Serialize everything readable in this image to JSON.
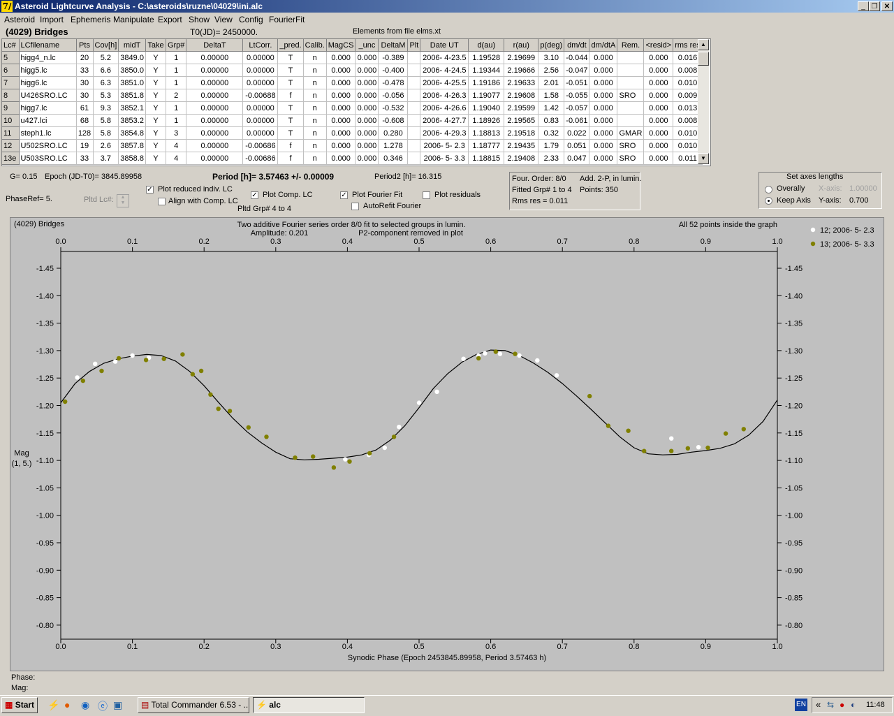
{
  "window": {
    "title": "Asteroid Lightcurve Analysis - C:\\asteroids\\ruzne\\04029\\ini.alc",
    "app_icon": "7/",
    "controls": [
      "minimize-icon",
      "restore-icon",
      "close-icon"
    ]
  },
  "menu": [
    "Asteroid",
    "Import",
    "Ephemeris",
    "Manipulate",
    "Export",
    "Show",
    "View",
    "Config",
    "FourierFit"
  ],
  "header": {
    "asteroid": "(4029) Bridges",
    "t0": "T0(JD)= 2450000.",
    "elements": "Elements from file elms.xt"
  },
  "table": {
    "columns": [
      "Lc#",
      "LCfilename",
      "Pts",
      "Cov[h]",
      "midT",
      "Take",
      "Grp#",
      "DeltaT",
      "LtCorr.",
      "_pred.",
      "Calib.",
      "MagCS",
      "_unc",
      "DeltaM",
      "Plt",
      "Date UT",
      "d(au)",
      "r(au)",
      "p(deg)",
      "dm/dt",
      "dm/dtA",
      "Rem.",
      "<resid>",
      "rms res"
    ],
    "rows": [
      [
        "5",
        "higg4_n.lc",
        "20",
        "5.2",
        "3849.0",
        "Y",
        "1",
        "0.00000",
        "0.00000",
        "T",
        "n",
        "0.000",
        "0.000",
        "-0.389",
        "",
        "2006- 4-23.5",
        "1.19528",
        "2.19699",
        "3.10",
        "-0.044",
        "0.000",
        "",
        "0.000",
        "0.016"
      ],
      [
        "6",
        "higg5.lc",
        "33",
        "6.6",
        "3850.0",
        "Y",
        "1",
        "0.00000",
        "0.00000",
        "T",
        "n",
        "0.000",
        "0.000",
        "-0.400",
        "",
        "2006- 4-24.5",
        "1.19344",
        "2.19666",
        "2.56",
        "-0.047",
        "0.000",
        "",
        "0.000",
        "0.008"
      ],
      [
        "7",
        "higg6.lc",
        "30",
        "6.3",
        "3851.0",
        "Y",
        "1",
        "0.00000",
        "0.00000",
        "T",
        "n",
        "0.000",
        "0.000",
        "-0.478",
        "",
        "2006- 4-25.5",
        "1.19186",
        "2.19633",
        "2.01",
        "-0.051",
        "0.000",
        "",
        "0.000",
        "0.010"
      ],
      [
        "8",
        "U426SRO.LC",
        "30",
        "5.3",
        "3851.8",
        "Y",
        "2",
        "0.00000",
        "-0.00688",
        "f",
        "n",
        "0.000",
        "0.000",
        "-0.056",
        "",
        "2006- 4-26.3",
        "1.19077",
        "2.19608",
        "1.58",
        "-0.055",
        "0.000",
        "SRO",
        "0.000",
        "0.009"
      ],
      [
        "9",
        "higg7.lc",
        "61",
        "9.3",
        "3852.1",
        "Y",
        "1",
        "0.00000",
        "0.00000",
        "T",
        "n",
        "0.000",
        "0.000",
        "-0.532",
        "",
        "2006- 4-26.6",
        "1.19040",
        "2.19599",
        "1.42",
        "-0.057",
        "0.000",
        "",
        "0.000",
        "0.013"
      ],
      [
        "10",
        "u427.lci",
        "68",
        "5.8",
        "3853.2",
        "Y",
        "1",
        "0.00000",
        "0.00000",
        "T",
        "n",
        "0.000",
        "0.000",
        "-0.608",
        "",
        "2006- 4-27.7",
        "1.18926",
        "2.19565",
        "0.83",
        "-0.061",
        "0.000",
        "",
        "0.000",
        "0.008"
      ],
      [
        "11",
        "steph1.lc",
        "128",
        "5.8",
        "3854.8",
        "Y",
        "3",
        "0.00000",
        "0.00000",
        "T",
        "n",
        "0.000",
        "0.000",
        "0.280",
        "",
        "2006- 4-29.3",
        "1.18813",
        "2.19518",
        "0.32",
        "0.022",
        "0.000",
        "GMAR",
        "0.000",
        "0.010"
      ],
      [
        "12",
        "U502SRO.LC",
        "19",
        "2.6",
        "3857.8",
        "Y",
        "4",
        "0.00000",
        "-0.00686",
        "f",
        "n",
        "0.000",
        "0.000",
        "1.278",
        "",
        "2006- 5- 2.3",
        "1.18777",
        "2.19435",
        "1.79",
        "0.051",
        "0.000",
        "SRO",
        "0.000",
        "0.010"
      ],
      [
        "13e",
        "U503SRO.LC",
        "33",
        "3.7",
        "3858.8",
        "Y",
        "4",
        "0.00000",
        "-0.00686",
        "f",
        "n",
        "0.000",
        "0.000",
        "0.346",
        "",
        "2006- 5- 3.3",
        "1.18815",
        "2.19408",
        "2.33",
        "0.047",
        "0.000",
        "SRO",
        "0.000",
        "0.011"
      ]
    ]
  },
  "info": {
    "g": "G= 0.15",
    "epoch": "Epoch (JD-T0)= 3845.89958",
    "period": "Period [h]= 3.57463 +/- 0.00009",
    "period2": "Period2 [h]= 16.315",
    "phaseref": "PhaseRef= 5.",
    "pltd_lc": "Pltd Lc#:",
    "pltd_grp": "Pltd Grp#  4  to   4"
  },
  "checkboxes": {
    "plot_reduced": {
      "label": "Plot reduced indiv. LC",
      "checked": true
    },
    "align_comp": {
      "label": "Align with Comp. LC",
      "checked": false
    },
    "plot_comp": {
      "label": "Plot Comp. LC",
      "checked": true
    },
    "plot_fourier": {
      "label": "Plot Fourier Fit",
      "checked": true
    },
    "plot_residuals": {
      "label": "Plot residuals",
      "checked": false
    },
    "autorefit": {
      "label": "AutoRefit Fourier",
      "checked": false
    }
  },
  "fourier_panel": {
    "order": "Four. Order:  8/0",
    "add": "Add. 2-P, in lumin.",
    "fitted": "Fitted Grp# 1 to 4",
    "points": "Points: 350",
    "rms": "Rms res      = 0.011"
  },
  "axes_panel": {
    "title": "Set axes lengths",
    "overally": "Overally",
    "keep_axis": "Keep Axis",
    "selected": "keep_axis",
    "x_label": "X-axis:",
    "x_value": "1.00000",
    "y_label": "Y-axis:",
    "y_value": "0.700"
  },
  "plot": {
    "name": "(4029) Bridges",
    "desc1": "Two additive Fourier series order 8/0 fit to selected groups in lumin.",
    "desc2": "Amplitude: 0.201",
    "desc3": "P2-component removed in plot",
    "inside": "All 52 points inside the graph",
    "ylabel1": "Mag",
    "ylabel2": "(1, 5.)",
    "xlabel": "Synodic Phase (Epoch 2453845.89958, Period 3.57463 h)",
    "phase_label": "Phase:",
    "mag_label": "Mag:"
  },
  "chart_data": {
    "type": "scatter",
    "xlim": [
      0,
      1
    ],
    "ylim": [
      -1.45,
      -0.8
    ],
    "y_inverted": true,
    "x_ticks": [
      "0.0",
      "0.1",
      "0.2",
      "0.3",
      "0.4",
      "0.5",
      "0.6",
      "0.7",
      "0.8",
      "0.9",
      "1.0"
    ],
    "y_ticks": [
      "-1.45",
      "-1.40",
      "-1.35",
      "-1.30",
      "-1.25",
      "-1.20",
      "-1.15",
      "-1.10",
      "-1.05",
      "-1.00",
      "-0.95",
      "-0.90",
      "-0.85",
      "-0.80"
    ],
    "grid": false,
    "legend_position": "right",
    "colors": {
      "series12": "#ffffff",
      "series13": "#808000",
      "fit": "#000000"
    },
    "series": [
      {
        "name": "12; 2006- 5- 2.3",
        "color": "#ffffff",
        "points": [
          [
            0.023,
            -1.251
          ],
          [
            0.048,
            -1.276
          ],
          [
            0.076,
            -1.28
          ],
          [
            0.1,
            -1.291
          ],
          [
            0.123,
            -1.287
          ],
          [
            0.397,
            -1.102
          ],
          [
            0.43,
            -1.11
          ],
          [
            0.452,
            -1.123
          ],
          [
            0.472,
            -1.161
          ],
          [
            0.5,
            -1.205
          ],
          [
            0.525,
            -1.225
          ],
          [
            0.562,
            -1.285
          ],
          [
            0.583,
            -1.291
          ],
          [
            0.592,
            -1.295
          ],
          [
            0.613,
            -1.294
          ],
          [
            0.64,
            -1.291
          ],
          [
            0.665,
            -1.282
          ],
          [
            0.692,
            -1.255
          ],
          [
            0.852,
            -1.14
          ],
          [
            0.89,
            -1.124
          ]
        ]
      },
      {
        "name": "13; 2006- 5- 3.3",
        "color": "#808000",
        "points": [
          [
            0.006,
            -1.207
          ],
          [
            0.031,
            -1.245
          ],
          [
            0.057,
            -1.263
          ],
          [
            0.081,
            -1.286
          ],
          [
            0.119,
            -1.283
          ],
          [
            0.144,
            -1.285
          ],
          [
            0.17,
            -1.293
          ],
          [
            0.184,
            -1.257
          ],
          [
            0.196,
            -1.263
          ],
          [
            0.209,
            -1.22
          ],
          [
            0.22,
            -1.194
          ],
          [
            0.236,
            -1.19
          ],
          [
            0.262,
            -1.16
          ],
          [
            0.287,
            -1.143
          ],
          [
            0.327,
            -1.105
          ],
          [
            0.352,
            -1.107
          ],
          [
            0.381,
            -1.087
          ],
          [
            0.403,
            -1.098
          ],
          [
            0.431,
            -1.113
          ],
          [
            0.465,
            -1.143
          ],
          [
            0.583,
            -1.286
          ],
          [
            0.607,
            -1.298
          ],
          [
            0.634,
            -1.294
          ],
          [
            0.738,
            -1.217
          ],
          [
            0.764,
            -1.163
          ],
          [
            0.792,
            -1.154
          ],
          [
            0.814,
            -1.117
          ],
          [
            0.852,
            -1.117
          ],
          [
            0.875,
            -1.122
          ],
          [
            0.903,
            -1.123
          ],
          [
            0.928,
            -1.149
          ],
          [
            0.953,
            -1.157
          ]
        ]
      }
    ],
    "fit_curve": [
      [
        0.0,
        -1.205
      ],
      [
        0.02,
        -1.24
      ],
      [
        0.04,
        -1.262
      ],
      [
        0.06,
        -1.277
      ],
      [
        0.08,
        -1.285
      ],
      [
        0.1,
        -1.29
      ],
      [
        0.12,
        -1.293
      ],
      [
        0.14,
        -1.291
      ],
      [
        0.16,
        -1.281
      ],
      [
        0.18,
        -1.262
      ],
      [
        0.2,
        -1.236
      ],
      [
        0.22,
        -1.206
      ],
      [
        0.24,
        -1.177
      ],
      [
        0.26,
        -1.152
      ],
      [
        0.28,
        -1.132
      ],
      [
        0.3,
        -1.115
      ],
      [
        0.32,
        -1.103
      ],
      [
        0.34,
        -1.101
      ],
      [
        0.36,
        -1.102
      ],
      [
        0.38,
        -1.104
      ],
      [
        0.4,
        -1.106
      ],
      [
        0.42,
        -1.11
      ],
      [
        0.44,
        -1.119
      ],
      [
        0.46,
        -1.137
      ],
      [
        0.48,
        -1.163
      ],
      [
        0.5,
        -1.196
      ],
      [
        0.52,
        -1.231
      ],
      [
        0.54,
        -1.258
      ],
      [
        0.56,
        -1.279
      ],
      [
        0.58,
        -1.293
      ],
      [
        0.6,
        -1.301
      ],
      [
        0.62,
        -1.3
      ],
      [
        0.64,
        -1.291
      ],
      [
        0.66,
        -1.277
      ],
      [
        0.68,
        -1.26
      ],
      [
        0.7,
        -1.24
      ],
      [
        0.72,
        -1.217
      ],
      [
        0.74,
        -1.193
      ],
      [
        0.76,
        -1.168
      ],
      [
        0.78,
        -1.143
      ],
      [
        0.8,
        -1.123
      ],
      [
        0.82,
        -1.112
      ],
      [
        0.84,
        -1.11
      ],
      [
        0.86,
        -1.111
      ],
      [
        0.88,
        -1.115
      ],
      [
        0.9,
        -1.118
      ],
      [
        0.92,
        -1.122
      ],
      [
        0.94,
        -1.13
      ],
      [
        0.96,
        -1.146
      ],
      [
        0.98,
        -1.171
      ],
      [
        1.0,
        -1.21
      ]
    ]
  },
  "taskbar": {
    "start": "Start",
    "task1": "Total Commander 6.53 - ...",
    "task2": "alc",
    "lang": "EN",
    "time": "11:48",
    "chevron": "«"
  }
}
